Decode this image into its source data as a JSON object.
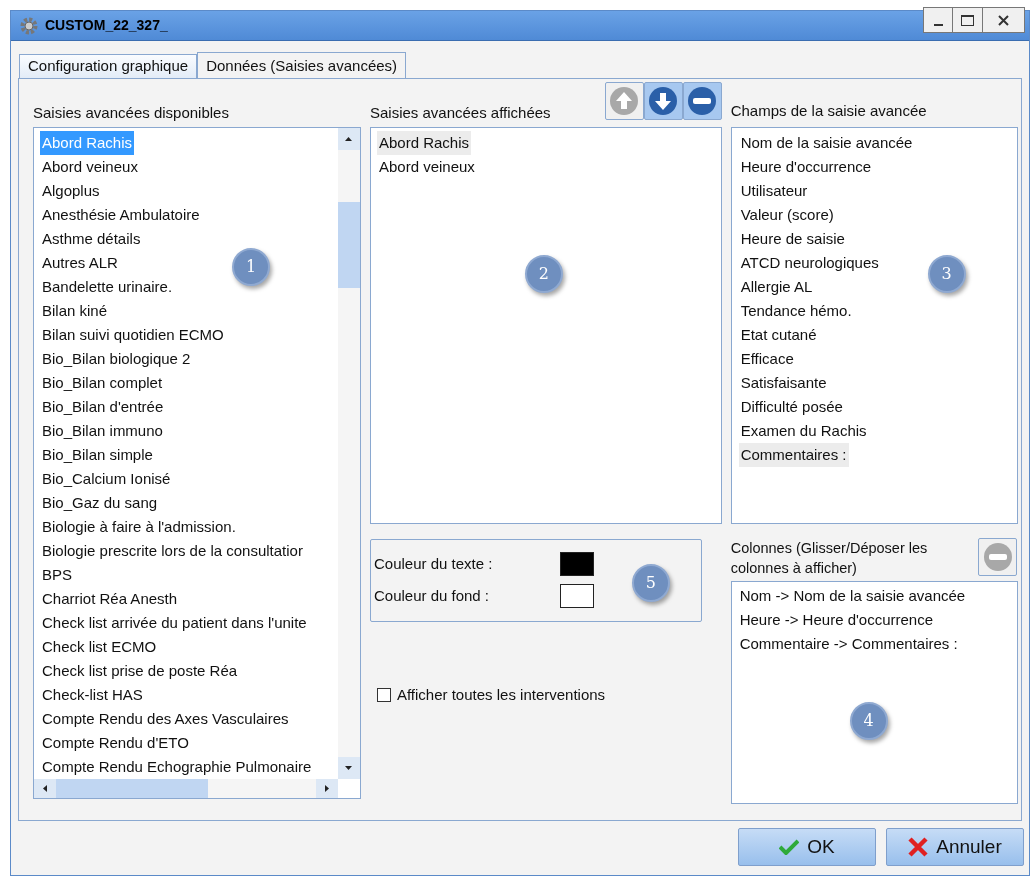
{
  "window": {
    "title": "CUSTOM_22_327_"
  },
  "tabs": [
    {
      "label": "Configuration graphique",
      "selected": false
    },
    {
      "label": "Données (Saisies avancées)",
      "selected": true
    }
  ],
  "available": {
    "label": "Saisies avancées disponibles",
    "badge": "1",
    "items": [
      {
        "label": "Abord Rachis",
        "selected": true
      },
      {
        "label": "Abord veineux",
        "selected": false
      },
      {
        "label": "Algoplus",
        "selected": false
      },
      {
        "label": "Anesthésie Ambulatoire",
        "selected": false
      },
      {
        "label": "Asthme détails",
        "selected": false
      },
      {
        "label": "Autres ALR",
        "selected": false
      },
      {
        "label": "Bandelette urinaire.",
        "selected": false
      },
      {
        "label": "Bilan kiné",
        "selected": false
      },
      {
        "label": "Bilan suivi quotidien ECMO",
        "selected": false
      },
      {
        "label": "Bio_Bilan biologique 2",
        "selected": false
      },
      {
        "label": "Bio_Bilan complet",
        "selected": false
      },
      {
        "label": "Bio_Bilan d'entrée",
        "selected": false
      },
      {
        "label": "Bio_Bilan immuno",
        "selected": false
      },
      {
        "label": "Bio_Bilan simple",
        "selected": false
      },
      {
        "label": "Bio_Calcium Ionisé",
        "selected": false
      },
      {
        "label": "Bio_Gaz du sang",
        "selected": false
      },
      {
        "label": "Biologie à faire à l'admission.",
        "selected": false
      },
      {
        "label": "Biologie prescrite lors de la consultatior",
        "selected": false
      },
      {
        "label": "BPS",
        "selected": false
      },
      {
        "label": "Charriot Réa Anesth",
        "selected": false
      },
      {
        "label": "Check list arrivée du patient dans l'unite",
        "selected": false
      },
      {
        "label": "Check list ECMO",
        "selected": false
      },
      {
        "label": "Check list prise de poste Réa",
        "selected": false
      },
      {
        "label": "Check-list HAS",
        "selected": false
      },
      {
        "label": "Compte Rendu des Axes Vasculaires",
        "selected": false
      },
      {
        "label": "Compte Rendu d'ETO",
        "selected": false
      },
      {
        "label": "Compte Rendu Echographie Pulmonaire",
        "selected": false
      }
    ]
  },
  "displayed": {
    "label": "Saisies avancées affichées",
    "badge": "2",
    "buttons": [
      {
        "kind": "up",
        "disabled": true
      },
      {
        "kind": "down",
        "disabled": false
      },
      {
        "kind": "remove",
        "disabled": false
      }
    ],
    "items": [
      {
        "label": "Abord Rachis",
        "selected": true
      },
      {
        "label": "Abord veineux",
        "selected": false
      }
    ]
  },
  "fields": {
    "label": "Champs de la saisie avancée",
    "badge": "3",
    "items": [
      {
        "label": "Nom de la saisie avancée",
        "selected": false
      },
      {
        "label": "Heure d'occurrence",
        "selected": false
      },
      {
        "label": "Utilisateur",
        "selected": false
      },
      {
        "label": "Valeur (score)",
        "selected": false
      },
      {
        "label": "Heure de saisie",
        "selected": false
      },
      {
        "label": "ATCD neurologiques",
        "selected": false
      },
      {
        "label": "Allergie AL",
        "selected": false
      },
      {
        "label": "Tendance hémo.",
        "selected": false
      },
      {
        "label": "Etat cutané",
        "selected": false
      },
      {
        "label": "Efficace",
        "selected": false
      },
      {
        "label": "Satisfaisante",
        "selected": false
      },
      {
        "label": "Difficulté posée",
        "selected": false
      },
      {
        "label": "Examen du Rachis",
        "selected": false
      },
      {
        "label": "Commentaires :",
        "selected": true
      }
    ]
  },
  "colors": {
    "badge": "5",
    "rows": [
      {
        "label": "Couleur du texte :",
        "color": "#000000"
      },
      {
        "label": "Couleur du fond :",
        "color": "#ffffff"
      }
    ]
  },
  "show_all": {
    "label": "Afficher toutes les interventions",
    "checked": false
  },
  "columns": {
    "label": "Colonnes (Glisser/Déposer les colonnes à afficher)",
    "badge": "4",
    "remove_disabled": true,
    "items": [
      {
        "label": "Nom -> Nom de la saisie avancée"
      },
      {
        "label": "Heure -> Heure d'occurrence"
      },
      {
        "label": "Commentaire -> Commentaires :"
      }
    ]
  },
  "buttons": [
    {
      "kind": "ok",
      "label": "OK"
    },
    {
      "kind": "cancel",
      "label": "Annuler"
    }
  ]
}
